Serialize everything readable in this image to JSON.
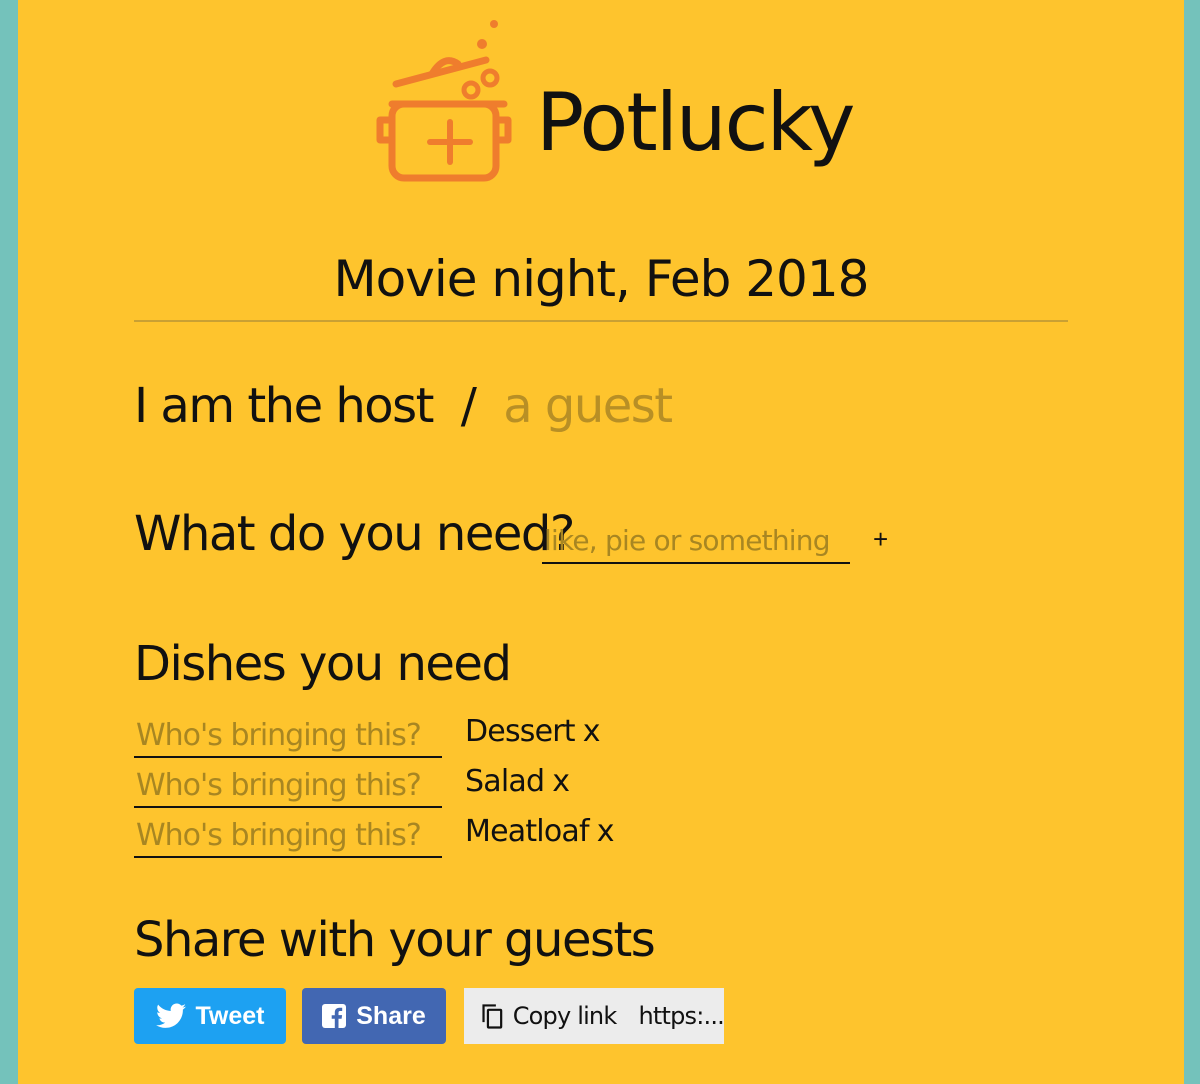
{
  "app": {
    "name": "Potlucky"
  },
  "event": {
    "title": "Movie night, Feb 2018"
  },
  "role": {
    "host_label": "I am the host",
    "separator": "/",
    "guest_label": "a guest"
  },
  "need": {
    "label": "What do you need?",
    "placeholder": "like, pie or something",
    "add_label": "+"
  },
  "dishes": {
    "title": "Dishes you need",
    "bringer_placeholder": "Who's bringing this?",
    "remove_label": "x",
    "items": [
      {
        "name": "Dessert"
      },
      {
        "name": "Salad"
      },
      {
        "name": "Meatloaf"
      }
    ]
  },
  "share": {
    "title": "Share with your guests",
    "tweet_label": "Tweet",
    "facebook_label": "Share",
    "copy_label": "Copy link",
    "link_preview": "https:..."
  },
  "colors": {
    "background": "#fec42d",
    "outer": "#74c2bb",
    "logo_orange": "#ef7d2d",
    "muted_text": "#b88f25",
    "twitter": "#1da1f2",
    "facebook": "#4267b2"
  },
  "icons": {
    "logo": "pot-icon",
    "tweet": "twitter-icon",
    "facebook": "facebook-icon",
    "copy": "copy-icon"
  }
}
